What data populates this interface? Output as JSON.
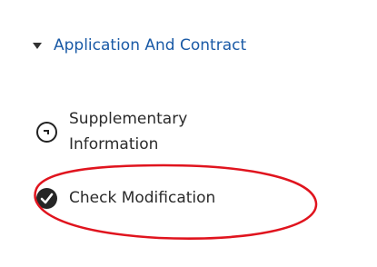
{
  "section": {
    "title": "Application And Contract",
    "expanded": true,
    "icon": "caret-down-icon"
  },
  "steps": [
    {
      "label": "Supplementary Information",
      "status": "pending",
      "icon": "pending-step-icon"
    },
    {
      "label": "Check Modification",
      "status": "completed",
      "icon": "check-circle-icon"
    }
  ],
  "colors": {
    "section_title": "#1a5aa6",
    "annotation": "#e0141e",
    "step_text": "#2b2b2b"
  }
}
